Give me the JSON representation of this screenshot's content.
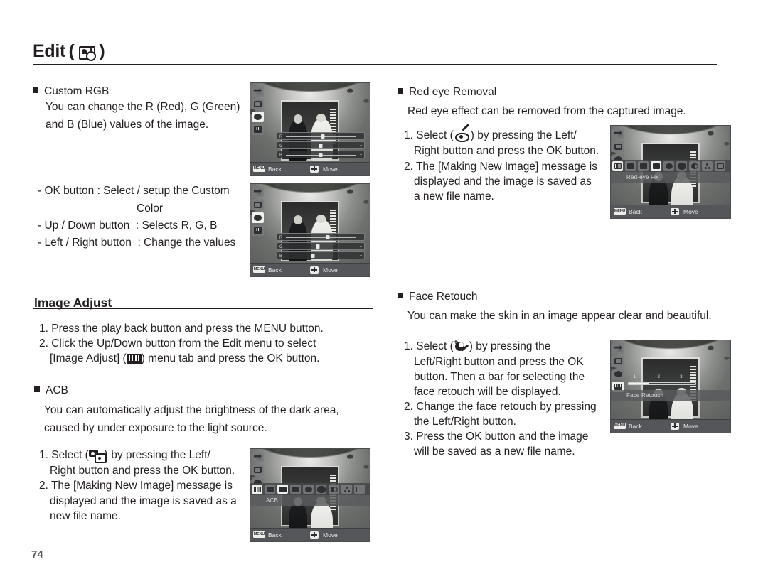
{
  "header": {
    "title": "Edit",
    "title_open_paren": "(",
    "title_close_paren": ")",
    "icon": "image-edit-icon"
  },
  "page_number": "74",
  "left_column": {
    "custom_rgb": {
      "heading": "Custom RGB",
      "body": "You can change the R (Red), G (Green)\nand B (Blue) values of the image.",
      "notes": [
        "- OK button : Select / setup the Custom",
        "Color",
        "- Up / Down button  : Selects R, G, B",
        "- Left / Right button  : Change the values"
      ]
    },
    "image_adjust": {
      "title": "Image Adjust",
      "steps": [
        "1. Press the play back button and press the MENU button.",
        "2. Click the Up/Down button from the Edit menu to select"
      ],
      "step2_cont_pre": "[Image Adjust] (",
      "step2_icon": "image-adjust-icon",
      "step2_cont_post": ") menu tab and press the OK button."
    },
    "acb": {
      "heading": "ACB",
      "body": "You can automatically adjust the brightness of the dark area,\ncaused by under exposure to the light source.",
      "step1_pre": "1. Select (",
      "step1_icon": "acb-icon",
      "step1_post": ") by pressing the Left/",
      "step1_cont": "Right button and press the OK button.",
      "step2": "2. The [Making New Image] message is",
      "step2_l2": "displayed and the image is saved as a",
      "step2_l3": "new file name."
    }
  },
  "right_column": {
    "red_eye": {
      "heading": "Red eye Removal",
      "body": "Red eye effect can be removed from the captured image.",
      "step1_pre": "1. Select (",
      "step1_icon": "red-eye-icon",
      "step1_post": ") by pressing the Left/",
      "step1_cont": "Right button and press the OK button.",
      "step2": "2. The [Making New Image] message is",
      "step2_l2": "displayed and the image is saved as",
      "step2_l3": "a new file name."
    },
    "face_retouch": {
      "heading": "Face Retouch",
      "body": "You can make the skin in an image appear clear and beautiful.",
      "step1_pre": "1. Select (",
      "step1_icon": "face-retouch-icon",
      "step1_post": ") by pressing the",
      "step1_l2": "Left/Right button and press the OK",
      "step1_l3": "button. Then a bar for selecting the",
      "step1_l4": "face retouch will be displayed.",
      "step2": "2. Change the face retouch by pressing",
      "step2_l2": "the Left/Right button.",
      "step3": "3. Press the OK button and the image",
      "step3_l2": "will be saved as a new file name."
    }
  },
  "screenshots": {
    "footer": {
      "menu_key": "MENU",
      "back_label": "Back",
      "move_label": "Move",
      "dpad_icon": "four-way-arrow-icon"
    },
    "rgb_top": {
      "name": "custom-rgb-screen-1",
      "tabs": [
        "resize-tab",
        "rotate-tab",
        "palette-tab",
        "image-adjust-tab"
      ],
      "selected_tab_index": 2,
      "rows": [
        {
          "left": "R",
          "right": "+",
          "knob_percent": 52
        },
        {
          "left": "G",
          "right": "+",
          "knob_percent": 50
        },
        {
          "left": "B",
          "right": "+",
          "knob_percent": 50
        }
      ]
    },
    "rgb_bottom": {
      "name": "custom-rgb-screen-2",
      "tabs": [
        "resize-tab",
        "rotate-tab",
        "palette-tab",
        "image-adjust-tab"
      ],
      "selected_tab_index": 2,
      "rows": [
        {
          "left": "R",
          "right": "+",
          "knob_percent": 58
        },
        {
          "left": "G",
          "right": "+",
          "knob_percent": 47
        },
        {
          "left": "B",
          "right": "+",
          "knob_percent": 41
        }
      ]
    },
    "red_eye_screen": {
      "name": "red-eye-fix-screen",
      "tabs": [
        "resize-tab",
        "rotate-tab",
        "palette-tab"
      ],
      "bar_icons": [
        "image-adjust-icon",
        "resize-icon",
        "acb-icon",
        "red-eye-icon",
        "face-retouch-icon",
        "brightness-icon",
        "contrast-icon",
        "saturation-icon",
        "noise-icon"
      ],
      "selected_bar_index": 3,
      "label": "Red-eye Fix"
    },
    "acb_screen": {
      "name": "acb-screen",
      "tabs": [
        "resize-tab",
        "rotate-tab",
        "palette-tab"
      ],
      "bar_icons": [
        "image-adjust-icon",
        "resize-icon",
        "acb-icon",
        "red-eye-icon",
        "face-retouch-icon",
        "brightness-icon",
        "contrast-icon",
        "saturation-icon",
        "noise-icon"
      ],
      "selected_bar_index": 2,
      "label": "ACB"
    },
    "face_retouch_screen": {
      "name": "face-retouch-screen",
      "tabs": [
        "resize-tab",
        "rotate-tab",
        "palette-tab",
        "image-adjust-tab"
      ],
      "selected_tab_index": 3,
      "levels": [
        "1",
        "2",
        "3"
      ],
      "selected_level": 1,
      "label": "Face Retouch"
    }
  },
  "colors": {
    "ink": "#231f20",
    "page_number": "#58595b",
    "lcd_bg": "#6f7073",
    "lcd_bar": "#464749",
    "lcd_footer": "#55565a"
  }
}
